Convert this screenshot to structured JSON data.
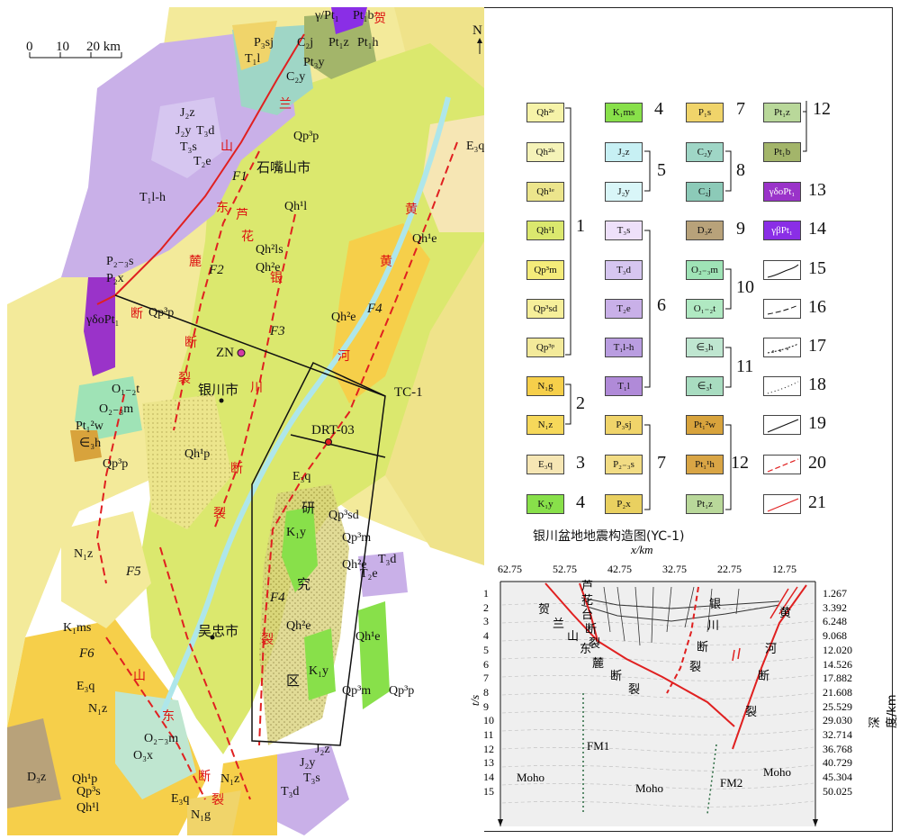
{
  "map": {
    "scale_ticks": [
      "0",
      "10",
      "20 km"
    ],
    "north": "N",
    "cities": [
      "石嘴山市",
      "银川市",
      "吴忠市"
    ],
    "station": "ZN",
    "profile_tc": "TC-1",
    "profile_drt": "DRT-03",
    "research_area": [
      "研",
      "究",
      "区"
    ],
    "faults": [
      "F1",
      "F2",
      "F3",
      "F4",
      "F5",
      "F6"
    ],
    "fault_name_chars": {
      "helan": [
        "贺",
        "兰",
        "山",
        "东",
        "麓",
        "断",
        "裂"
      ],
      "luhua": [
        "芦",
        "花",
        "台",
        "断",
        "裂"
      ],
      "yinchuan": [
        "银",
        "川",
        "断",
        "裂"
      ],
      "yellow": [
        "黄",
        "河",
        "断",
        "裂"
      ],
      "niushou": [
        "牛",
        "首",
        "山",
        "东",
        "麓",
        "断",
        "裂"
      ]
    },
    "units": [
      "γ/Pt₁",
      "Pt₁b",
      "P₃sj",
      "C₂j",
      "Pt₁z",
      "Pt₁h",
      "T₁l",
      "C₂y",
      "Pt₃y",
      "J₂z",
      "J₂y",
      "T₃d",
      "T₃s",
      "T₂e",
      "Qp³p",
      "F1",
      "E₃q",
      "T₁l-h",
      "Qh¹l",
      "Qh²ls",
      "Qh²e",
      "Qh¹e",
      "P₂₋₃s",
      "P₂x",
      "γδoPt₁",
      "Qp³p",
      "O₁₋₂t",
      "O₂₋₃m",
      "Pt₁²w",
      "∈₃h",
      "Qh¹p",
      "Qp³sd",
      "Qp³m",
      "K₁y",
      "N₁z",
      "K₁ms",
      "E₃q",
      "N₁z",
      "Qh¹p",
      "D₃z",
      "Qp³s",
      "O₂₋₃m",
      "O₃x",
      "N₁z",
      "E₃q",
      "N₁g",
      "J₂z",
      "J₂y",
      "T₃s",
      "T₃d"
    ]
  },
  "legend": {
    "title": "银川盆地地震构造图(YC-1)",
    "groups": [
      {
        "num": "1",
        "items": [
          "Qh²ᵉ",
          "Qh²ˡˢ",
          "Qh¹ᵉ",
          "Qh¹l",
          "Qp³m",
          "Qp³sd",
          "Qp³ᵖ"
        ]
      },
      {
        "num": "2",
        "items": [
          "N₁g",
          "N₁z"
        ]
      },
      {
        "num": "3",
        "items": [
          "E₃q"
        ]
      },
      {
        "num": "4",
        "items": [
          "K₁y",
          "K₁ms"
        ]
      },
      {
        "num": "5",
        "items": [
          "J₂z",
          "J₂y"
        ]
      },
      {
        "num": "6",
        "items": [
          "T₃s",
          "T₃d",
          "T₂e",
          "T₁l-h",
          "T₁l"
        ]
      },
      {
        "num": "7",
        "items": [
          "P₃sj",
          "P₂₋₃s",
          "P₂x",
          "P₁s"
        ]
      },
      {
        "num": "8",
        "items": [
          "C₂y",
          "C₂j"
        ]
      },
      {
        "num": "9",
        "items": [
          "D₃z"
        ]
      },
      {
        "num": "10",
        "items": [
          "O₂₋₃m",
          "O₁₋₂t"
        ]
      },
      {
        "num": "11",
        "items": [
          "∈₃h",
          "∈₃t"
        ]
      },
      {
        "num": "12",
        "items": [
          "Pt₁²w",
          "Pt₁¹h",
          "Pt₁z",
          "Pt₁z",
          "Pt₁b"
        ]
      },
      {
        "num": "13",
        "items": [
          "γδoPt₁"
        ]
      },
      {
        "num": "14",
        "items": [
          "γβPt₁"
        ]
      },
      {
        "num": "15",
        "items": []
      },
      {
        "num": "16",
        "items": []
      },
      {
        "num": "17",
        "items": []
      },
      {
        "num": "18",
        "items": []
      },
      {
        "num": "19",
        "items": []
      },
      {
        "num": "20",
        "items": []
      },
      {
        "num": "21",
        "items": []
      }
    ],
    "colors": {
      "qh": "#f5f3a8",
      "qp": "#f4ec7a",
      "n": "#f6cf4a",
      "e": "#f6e6b4",
      "k": "#88e04a",
      "j": "#c7f0f4",
      "t": "#c9b0e8",
      "p": "#f0d46a",
      "c": "#9fd6c6",
      "d": "#b8a27a",
      "o": "#9fe3b6",
      "cam": "#bfe6d0",
      "pt": "#d8a33c",
      "ptz": "#b9d89a",
      "ptb": "#a3b56a",
      "gdo": "#9a33c9",
      "gb": "#8a2ee6"
    }
  },
  "profile": {
    "x_label": "x/km",
    "x_ticks": [
      "62.75",
      "52.75",
      "42.75",
      "32.75",
      "22.75",
      "12.75"
    ],
    "t_label": "t/s",
    "t_ticks": [
      "1",
      "2",
      "3",
      "4",
      "5",
      "6",
      "7",
      "8",
      "9",
      "10",
      "11",
      "12",
      "13",
      "14",
      "15"
    ],
    "depth_label": "深度/km",
    "depth_ticks": [
      "1.267",
      "3.392",
      "6.248",
      "9.068",
      "12.020",
      "14.526",
      "17.882",
      "21.608",
      "25.529",
      "29.030",
      "32.714",
      "36.768",
      "40.729",
      "45.304",
      "50.025"
    ],
    "moho": [
      "Moho",
      "Moho",
      "Moho"
    ],
    "fm": [
      "FM1",
      "FM2"
    ],
    "fault_chars_left": [
      "贺",
      "兰",
      "山",
      "东",
      "麓",
      "断",
      "裂"
    ],
    "fault_chars_luhua": [
      "芦",
      "花",
      "台",
      "断",
      "裂"
    ],
    "fault_chars_yinchuan": [
      "银",
      "川",
      "断",
      "裂"
    ],
    "fault_chars_yellow": [
      "黄",
      "河",
      "断",
      "裂"
    ]
  }
}
